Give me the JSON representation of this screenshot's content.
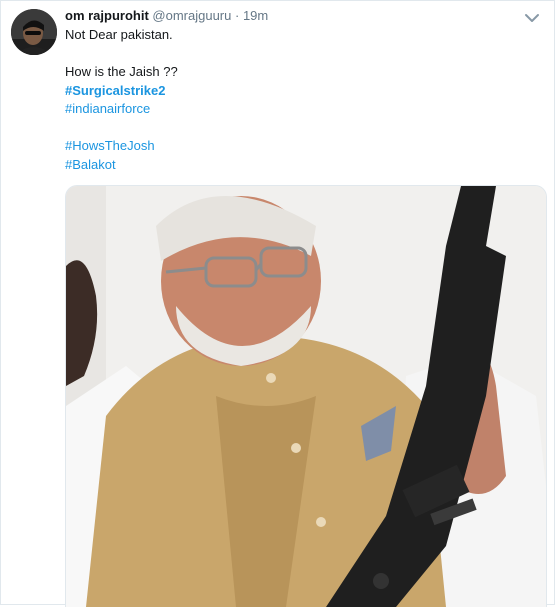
{
  "author": {
    "name": "om rajpurohit",
    "handle": "@omrajguuru",
    "separator": "·",
    "time": "19m"
  },
  "tweet": {
    "line1": "Not Dear pakistan.",
    "line2": "How is the Jaish ??",
    "hashtags": {
      "h1": "#Surgicalstrike2",
      "h2": "#indianairforce",
      "h3": "#HowsTheJosh",
      "h4": "#Balakot"
    }
  },
  "icons": {
    "avatar": "avatar-image",
    "menu": "chevron-down-icon"
  },
  "colors": {
    "link": "#1b95e0",
    "muted": "#657786",
    "text": "#14171a",
    "border": "#e1e8ed"
  }
}
